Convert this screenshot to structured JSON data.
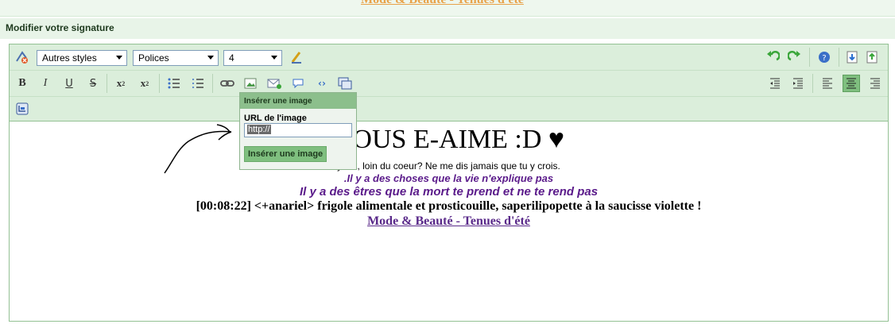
{
  "top_link": "Mode & Beauté - Tenues d'été",
  "section_title": "Modifier votre signature",
  "toolbar": {
    "styles_select": "Autres styles",
    "fonts_select": "Polices",
    "size_select": "4",
    "bold": "B",
    "italic": "I",
    "underline": "U",
    "strike": "S"
  },
  "popup": {
    "title": "Insérer une image",
    "url_label": "URL de l'image",
    "url_value": "http://",
    "insert_button": "Insérer une image"
  },
  "content": {
    "title": "VOUS E-AIME :D ♥",
    "line2": "yeux, loin du coeur? Ne me dis jamais que tu y crois.",
    "line3": ".Il y a des choses que la vie n'explique pas",
    "line4": "Il y a des êtres que la mort te prend et ne te rend pas",
    "line5": "[00:08:22] <+anariel> frigole alimentale et prosticouille, saperilipopette à la saucisse violette !",
    "line6": "Mode & Beauté - Tenues d'été"
  }
}
